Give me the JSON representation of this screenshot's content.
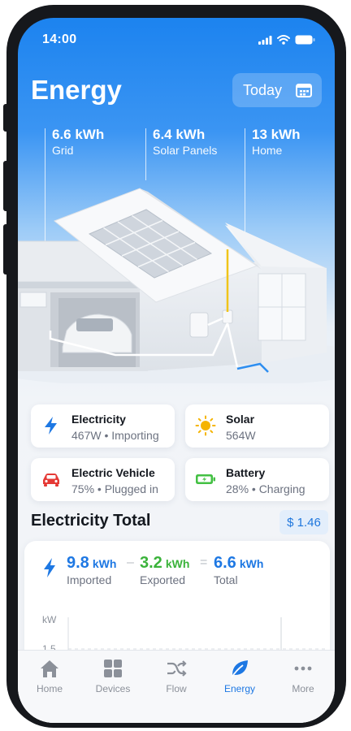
{
  "status": {
    "time": "14:00"
  },
  "header": {
    "title": "Energy",
    "period_button": "Today"
  },
  "summary": [
    {
      "value": "6.6 kWh",
      "label": "Grid"
    },
    {
      "value": "6.4 kWh",
      "label": "Solar Panels"
    },
    {
      "value": "13 kWh",
      "label": "Home"
    }
  ],
  "cards": {
    "electricity": {
      "title": "Electricity",
      "subtitle": "467W • Importing",
      "icon": "lightning-icon"
    },
    "solar": {
      "title": "Solar",
      "subtitle": "564W",
      "icon": "sun-icon"
    },
    "ev": {
      "title": "Electric Vehicle",
      "subtitle": "75% • Plugged in",
      "icon": "car-icon"
    },
    "battery": {
      "title": "Battery",
      "subtitle": "28% • Charging",
      "icon": "battery-icon"
    }
  },
  "electricity_total": {
    "title": "Electricity Total",
    "cost": "$ 1.46",
    "imported": {
      "value": "9.8",
      "unit": "kWh",
      "label": "Imported"
    },
    "exported": {
      "value": "3.2",
      "unit": "kWh",
      "label": "Exported"
    },
    "total": {
      "value": "6.6",
      "unit": "kWh",
      "label": "Total"
    },
    "chart": {
      "unit_label": "kW",
      "tick_label": "1.5"
    }
  },
  "tabs": [
    {
      "label": "Home",
      "icon": "home-icon"
    },
    {
      "label": "Devices",
      "icon": "grid-icon"
    },
    {
      "label": "Flow",
      "icon": "shuffle-icon"
    },
    {
      "label": "Energy",
      "icon": "leaf-icon",
      "active": true
    },
    {
      "label": "More",
      "icon": "more-icon"
    }
  ],
  "colors": {
    "accent_blue": "#1e78e3",
    "export_green": "#3bb33b",
    "ev_red": "#e53935",
    "battery_green": "#43c043",
    "sun_yellow": "#f5b400"
  }
}
